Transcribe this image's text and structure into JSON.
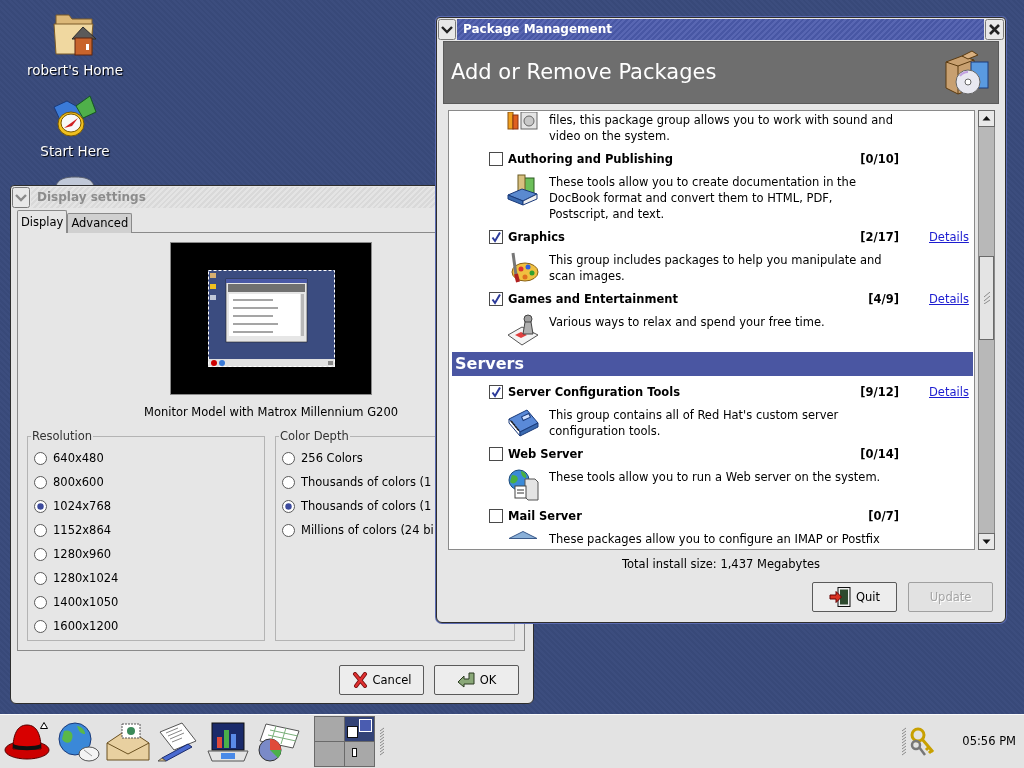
{
  "desktop": {
    "icons": [
      {
        "label": "robert's Home"
      },
      {
        "label": "Start Here"
      }
    ]
  },
  "display_settings": {
    "title": "Display settings",
    "active": false,
    "tabs": [
      {
        "label": "Display",
        "selected": true
      },
      {
        "label": "Advanced",
        "selected": false
      }
    ],
    "monitor_caption": "Monitor Model with Matrox Millennium G200",
    "resolution": {
      "title": "Resolution",
      "options": [
        {
          "label": "640x480",
          "selected": false
        },
        {
          "label": "800x600",
          "selected": false
        },
        {
          "label": "1024x768",
          "selected": true
        },
        {
          "label": "1152x864",
          "selected": false
        },
        {
          "label": "1280x960",
          "selected": false
        },
        {
          "label": "1280x1024",
          "selected": false
        },
        {
          "label": "1400x1050",
          "selected": false
        },
        {
          "label": "1600x1200",
          "selected": false
        }
      ]
    },
    "color_depth": {
      "title": "Color Depth",
      "options": [
        {
          "label": "256 Colors",
          "selected": false
        },
        {
          "label": "Thousands of colors (1",
          "selected": false
        },
        {
          "label": "Thousands of colors (1",
          "selected": true
        },
        {
          "label": "Millions of colors (24 bi",
          "selected": false
        }
      ]
    },
    "buttons": [
      {
        "kind": "cancel",
        "label": "Cancel"
      },
      {
        "kind": "ok",
        "label": "OK"
      }
    ]
  },
  "package_management": {
    "title": "Package Management",
    "active": true,
    "banner_title": "Add or Remove Packages",
    "items": [
      {
        "kind": "fragment",
        "description": "files, this package group allows you to work with sound and\nvideo on the system."
      },
      {
        "kind": "group",
        "name": "Authoring and Publishing",
        "count": "[0/10]",
        "checked": false,
        "description": "These tools allow you to create documentation in the\nDocBook format and convert them to HTML, PDF,\nPostscript, and text."
      },
      {
        "kind": "group",
        "name": "Graphics",
        "count": "[2/17]",
        "checked": true,
        "details": "Details",
        "description": "This group includes packages to help you manipulate and\nscan images."
      },
      {
        "kind": "group",
        "name": "Games and Entertainment",
        "count": "[4/9]",
        "checked": true,
        "details": "Details",
        "description": "Various ways to relax and spend your free time."
      },
      {
        "kind": "section",
        "title": "Servers"
      },
      {
        "kind": "group",
        "name": "Server Configuration Tools",
        "count": "[9/12]",
        "checked": true,
        "details": "Details",
        "description": "This group contains all of Red Hat's custom server\nconfiguration tools."
      },
      {
        "kind": "group",
        "name": "Web Server",
        "count": "[0/14]",
        "checked": false,
        "description": "These tools allow you to run a Web server on the system."
      },
      {
        "kind": "group",
        "name": "Mail Server",
        "count": "[0/7]",
        "checked": false,
        "description": "These packages allow you to configure an IMAP or Postfix"
      }
    ],
    "total_size": "Total install size: 1,437 Megabytes",
    "buttons": [
      {
        "kind": "quit",
        "label": "Quit",
        "disabled": false
      },
      {
        "kind": "update",
        "label": "Update",
        "disabled": true
      }
    ]
  },
  "panel": {
    "workspaces": [
      {
        "selected": false
      },
      {
        "selected": true
      },
      {
        "selected": false
      },
      {
        "selected": false
      }
    ],
    "clock": "05:56 PM"
  }
}
